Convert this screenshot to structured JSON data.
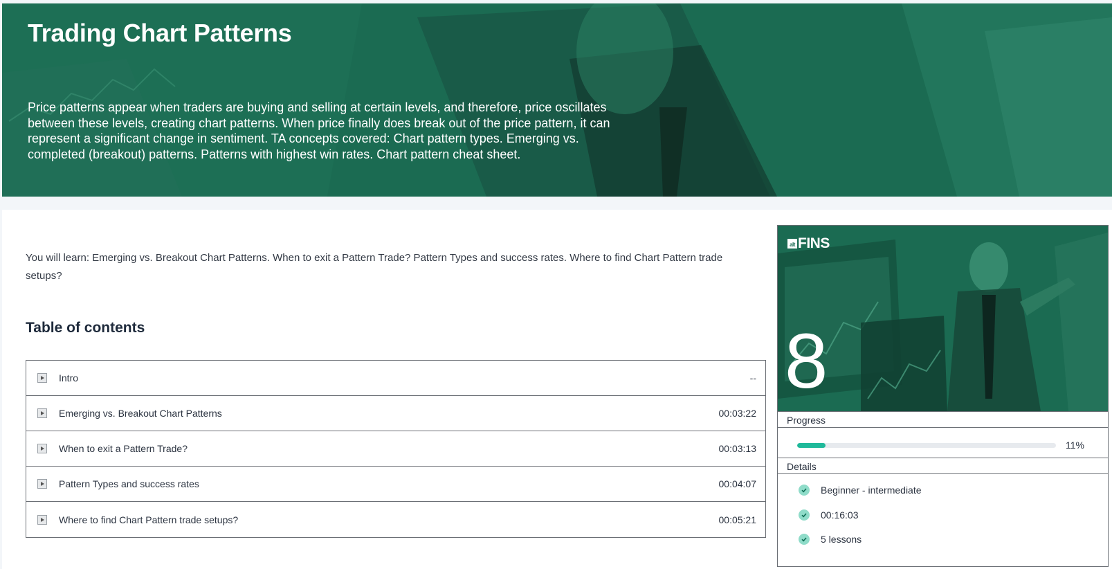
{
  "course": {
    "title": "Trading Chart Patterns",
    "description": "Price patterns appear when traders are buying and selling at certain levels, and therefore, price oscillates between these levels, creating chart patterns. When price finally does break out of the price pattern, it can represent a significant change in sentiment. TA concepts covered: Chart pattern types. Emerging vs. completed (breakout) patterns. Patterns with highest win rates. Chart pattern cheat sheet.",
    "learn": "You will learn: Emerging vs. Breakout Chart Patterns. When to exit a Pattern Trade? Pattern Types and success rates. Where to find Chart Pattern trade setups?"
  },
  "toc": {
    "title": "Table of contents",
    "lessons": [
      {
        "label": "Intro",
        "duration": "--"
      },
      {
        "label": "Emerging vs. Breakout Chart Patterns",
        "duration": "00:03:22"
      },
      {
        "label": "When to exit a Pattern Trade?",
        "duration": "00:03:13"
      },
      {
        "label": "Pattern Types and success rates",
        "duration": "00:04:07"
      },
      {
        "label": "Where to find Chart Pattern trade setups?",
        "duration": "00:05:21"
      }
    ]
  },
  "card": {
    "logo_small": "alt",
    "logo_text": "FINS",
    "number": "8",
    "progress_label": "Progress",
    "progress_value": 11,
    "progress_text": "11%",
    "details_label": "Details",
    "details": [
      "Beginner - intermediate",
      "00:16:03",
      "5 lessons"
    ]
  },
  "colors": {
    "brand_green": "#1a6b52",
    "accent": "#1fb99a",
    "check_bg": "#8fdcc9"
  },
  "icons": {
    "lesson": "video-play-icon",
    "detail": "check-circle-icon"
  }
}
